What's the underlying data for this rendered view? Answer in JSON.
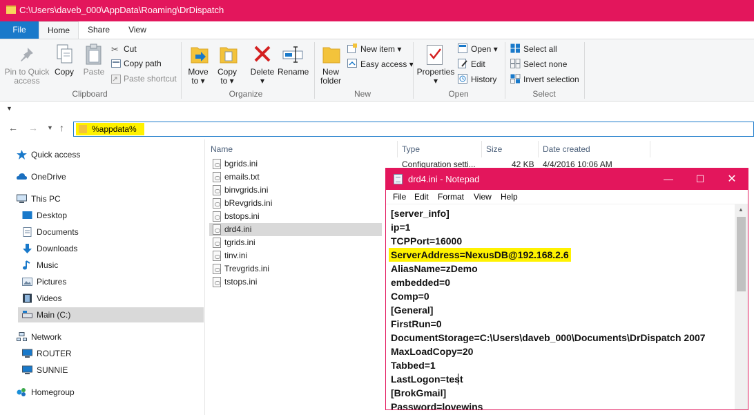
{
  "window": {
    "title": "C:\\Users\\daveb_000\\AppData\\Roaming\\DrDispatch"
  },
  "ribbon_tabs": [
    "File",
    "Home",
    "Share",
    "View"
  ],
  "ribbon": {
    "clipboard": {
      "pin": [
        "Pin to Quick",
        "access"
      ],
      "copy": "Copy",
      "paste": "Paste",
      "cut": "Cut",
      "copy_path": "Copy path",
      "paste_shortcut": "Paste shortcut",
      "group": "Clipboard"
    },
    "organize": {
      "move_to": [
        "Move",
        "to ▾"
      ],
      "copy_to": [
        "Copy",
        "to ▾"
      ],
      "delete": [
        "Delete",
        "▾"
      ],
      "rename": "Rename",
      "group": "Organize"
    },
    "new": {
      "new_folder": [
        "New",
        "folder"
      ],
      "new_item": "New item ▾",
      "easy_access": "Easy access ▾",
      "group": "New"
    },
    "open": {
      "properties": [
        "Properties",
        "▾"
      ],
      "open": "Open ▾",
      "edit": "Edit",
      "history": "History",
      "group": "Open"
    },
    "select": {
      "select_all": "Select all",
      "select_none": "Select none",
      "invert": "Invert selection",
      "group": "Select"
    }
  },
  "address": {
    "value": "%appdata%"
  },
  "nav_pane": {
    "items": [
      {
        "label": "Quick access"
      },
      {
        "label": "OneDrive"
      },
      {
        "label": "This PC"
      },
      {
        "label": "Desktop"
      },
      {
        "label": "Documents"
      },
      {
        "label": "Downloads"
      },
      {
        "label": "Music"
      },
      {
        "label": "Pictures"
      },
      {
        "label": "Videos"
      },
      {
        "label": "Main (C:)"
      },
      {
        "label": "Network"
      },
      {
        "label": "ROUTER"
      },
      {
        "label": "SUNNIE"
      },
      {
        "label": "Homegroup"
      }
    ]
  },
  "file_list": {
    "columns": [
      "Name",
      "Type",
      "Size",
      "Date created"
    ],
    "files": [
      {
        "name": "bgrids.ini",
        "type": "Configuration setti...",
        "size": "42 KB",
        "date": "4/4/2016 10:06 AM"
      },
      {
        "name": "emails.txt"
      },
      {
        "name": "binvgrids.ini"
      },
      {
        "name": "bRevgrids.ini"
      },
      {
        "name": "bstops.ini"
      },
      {
        "name": "drd4.ini"
      },
      {
        "name": "tgrids.ini"
      },
      {
        "name": "tinv.ini"
      },
      {
        "name": "Trevgrids.ini"
      },
      {
        "name": "tstops.ini"
      }
    ]
  },
  "notepad": {
    "title": "drd4.ini - Notepad",
    "menu": [
      "File",
      "Edit",
      "Format",
      "View",
      "Help"
    ],
    "lines": [
      "[server_info]",
      "ip=1",
      "TCPPort=16000",
      "ServerAddress=NexusDB@192.168.2.6",
      "AliasName=zDemo",
      "embedded=0",
      "Comp=0",
      "[General]",
      "FirstRun=0",
      "DocumentStorage=C:\\Users\\daveb_000\\Documents\\DrDispatch 2007",
      "MaxLoadCopy=20",
      "Tabbed=1",
      "LastLogon=test",
      "[BrokGmail]",
      "Password=lovewins"
    ]
  }
}
